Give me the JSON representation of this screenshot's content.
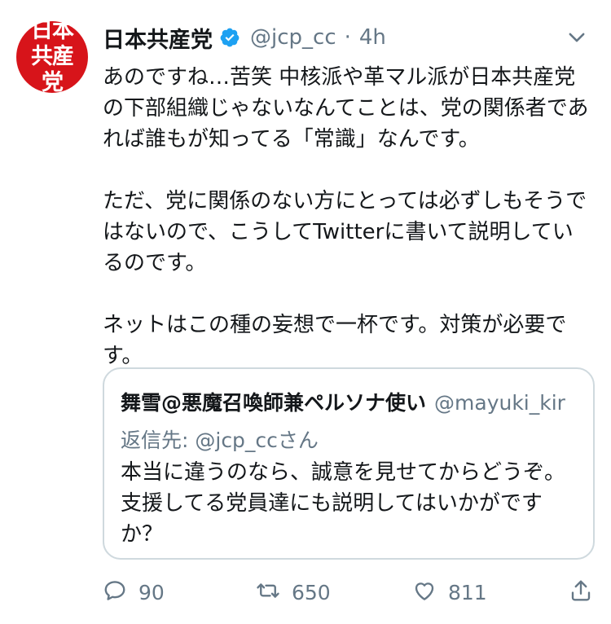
{
  "account": {
    "avatar_text": "日本共産党",
    "display_name": "日本共産党",
    "handle": "@jcp_cc",
    "separator": "·",
    "time": "4h"
  },
  "tweet": {
    "text": "あのですね…苦笑 中核派や革マル派が日本共産党の下部組織じゃないなんてことは、党の関係者であれば誰もが知ってる「常識」なんです。\n\nただ、党に関係のない方にとっては必ずしもそうではないので、こうしてTwitterに書いて説明しているのです。\n\nネットはこの種の妄想で一杯です。対策が必要です。"
  },
  "quoted": {
    "display_name": "舞雪@悪魔召喚師兼ペルソナ使い",
    "handle": "@mayuki_kir",
    "reply_to": "返信先: @jcp_ccさん",
    "text": "本当に違うのなら、誠意を見せてからどうぞ。支援してる党員達にも説明してはいかがですか？"
  },
  "actions": {
    "replies": "90",
    "retweets": "650",
    "likes": "811"
  },
  "colors": {
    "brand_red": "#d7141a",
    "verified_blue": "#1da1f2",
    "secondary_text": "#657786",
    "border": "#cfd9de"
  },
  "icons": [
    "verified-badge-icon",
    "chevron-down-icon",
    "reply-icon",
    "retweet-icon",
    "like-icon",
    "share-icon"
  ]
}
